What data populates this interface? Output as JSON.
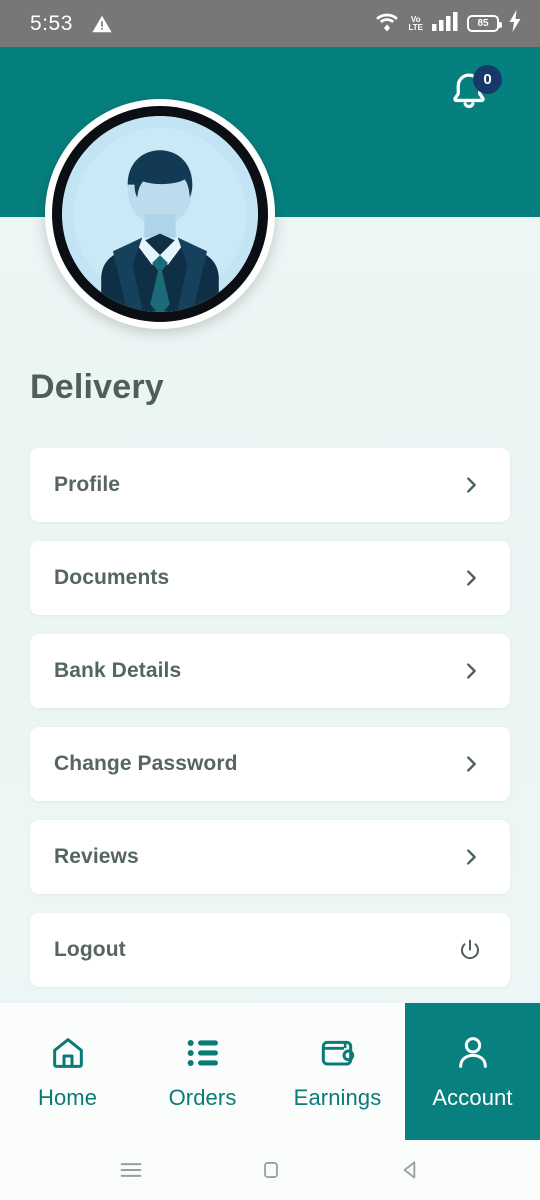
{
  "statusbar": {
    "time": "5:53",
    "warning_icon": "warning-triangle-icon",
    "wifi_icon": "wifi-icon",
    "volte_top": "Vo",
    "volte_bottom": "LTE",
    "signal_icon": "cellular-signal-icon",
    "battery_level": "85",
    "charging_icon": "charging-bolt-icon"
  },
  "header": {
    "background_color": "#06807f",
    "notification": {
      "icon": "bell-icon",
      "badge_count": "0",
      "badge_color": "#17386b"
    },
    "avatar": {
      "icon": "default-user-avatar",
      "bg_color": "#bfe3f5"
    }
  },
  "page": {
    "title": "Delivery",
    "title_color": "#4d5f58",
    "background_color": "#eef6f5"
  },
  "menu": {
    "items": [
      {
        "label": "Profile",
        "icon": "chevron-right-icon",
        "name": "profile"
      },
      {
        "label": "Documents",
        "icon": "chevron-right-icon",
        "name": "documents"
      },
      {
        "label": "Bank Details",
        "icon": "chevron-right-icon",
        "name": "bank-details"
      },
      {
        "label": "Change Password",
        "icon": "chevron-right-icon",
        "name": "change-password"
      },
      {
        "label": "Reviews",
        "icon": "chevron-right-icon",
        "name": "reviews"
      },
      {
        "label": "Logout",
        "icon": "power-icon",
        "name": "logout"
      }
    ]
  },
  "bottom_nav": {
    "active_color": "#07807f",
    "inactive_color": "#0b7b76",
    "items": [
      {
        "label": "Home",
        "icon": "home-icon",
        "active": false
      },
      {
        "label": "Orders",
        "icon": "list-icon",
        "active": false
      },
      {
        "label": "Earnings",
        "icon": "wallet-icon",
        "active": false
      },
      {
        "label": "Account",
        "icon": "person-icon",
        "active": true
      }
    ]
  },
  "system_nav": {
    "recents": "recents-menu-icon",
    "home": "home-square-icon",
    "back": "back-triangle-icon"
  }
}
